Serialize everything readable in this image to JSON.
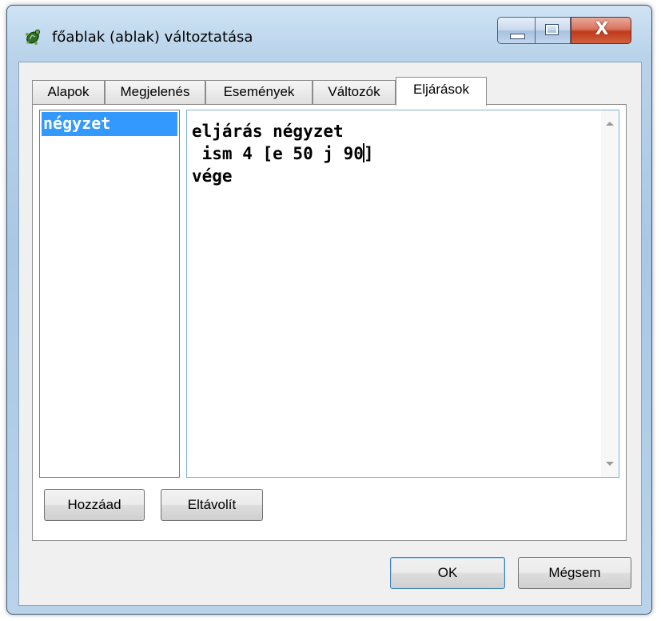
{
  "window": {
    "title": "főablak (ablak) változtatása",
    "icon": "turtle-app-icon",
    "controls": {
      "minimize": "minimize",
      "maximize": "maximize",
      "close": "X"
    }
  },
  "tabs": [
    {
      "label": "Alapok"
    },
    {
      "label": "Megjelenés"
    },
    {
      "label": "Események"
    },
    {
      "label": "Változók"
    },
    {
      "label": "Eljárások",
      "active": true
    }
  ],
  "procedures": {
    "items": [
      "négyzet"
    ],
    "selected": "négyzet"
  },
  "editor": {
    "lines": [
      "eljárás négyzet",
      " ism 4 [e 50 j 90",
      "]",
      "vége"
    ]
  },
  "buttons": {
    "add": "Hozzáad",
    "remove": "Eltávolít",
    "ok": "OK",
    "cancel": "Mégsem"
  },
  "colors": {
    "selection": "#3399ff",
    "close_button": "#c03a1a"
  }
}
